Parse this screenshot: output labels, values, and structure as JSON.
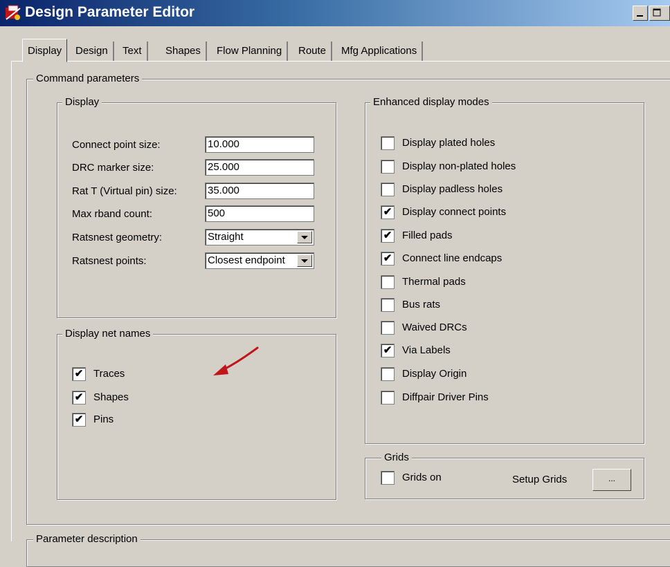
{
  "window": {
    "title": "Design Parameter Editor"
  },
  "tabs": [
    "Display",
    "Design",
    "Text",
    "Shapes",
    "Flow Planning",
    "Route",
    "Mfg Applications"
  ],
  "command_group": {
    "label": "Command parameters"
  },
  "display_group": {
    "label": "Display",
    "fields": [
      {
        "label": "Connect point size:",
        "value": "10.000"
      },
      {
        "label": "DRC marker size:",
        "value": "25.000"
      },
      {
        "label": "Rat T (Virtual pin) size:",
        "value": "35.000"
      },
      {
        "label": "Max rband count:",
        "value": "500"
      },
      {
        "label": "Ratsnest geometry:",
        "value": "Straight"
      },
      {
        "label": "Ratsnest points:",
        "value": "Closest endpoint"
      }
    ]
  },
  "net_names_group": {
    "label": "Display net names",
    "items": [
      {
        "label": "Traces",
        "checked": true
      },
      {
        "label": "Shapes",
        "checked": true
      },
      {
        "label": "Pins",
        "checked": true
      }
    ]
  },
  "enhanced_group": {
    "label": "Enhanced display modes",
    "items": [
      {
        "label": "Display plated holes",
        "checked": false
      },
      {
        "label": "Display non-plated holes",
        "checked": false
      },
      {
        "label": "Display padless holes",
        "checked": false
      },
      {
        "label": "Display connect points",
        "checked": true
      },
      {
        "label": "Filled pads",
        "checked": true
      },
      {
        "label": "Connect line endcaps",
        "checked": true
      },
      {
        "label": "Thermal pads",
        "checked": false
      },
      {
        "label": "Bus rats",
        "checked": false
      },
      {
        "label": "Waived DRCs",
        "checked": false
      },
      {
        "label": "Via Labels",
        "checked": true
      },
      {
        "label": "Display Origin",
        "checked": false
      },
      {
        "label": "Diffpair Driver Pins",
        "checked": false
      }
    ]
  },
  "grids_group": {
    "label": "Grids",
    "grids_on": {
      "label": "Grids on",
      "checked": false
    },
    "setup_label": "Setup Grids",
    "setup_button": "..."
  },
  "param_desc_group": {
    "label": "Parameter description"
  },
  "check_glyph": "✔",
  "colors": {
    "face": "#d4d0c8",
    "title_start": "#0a246a",
    "title_end": "#a6caf0",
    "arrow": "#c0161a"
  }
}
